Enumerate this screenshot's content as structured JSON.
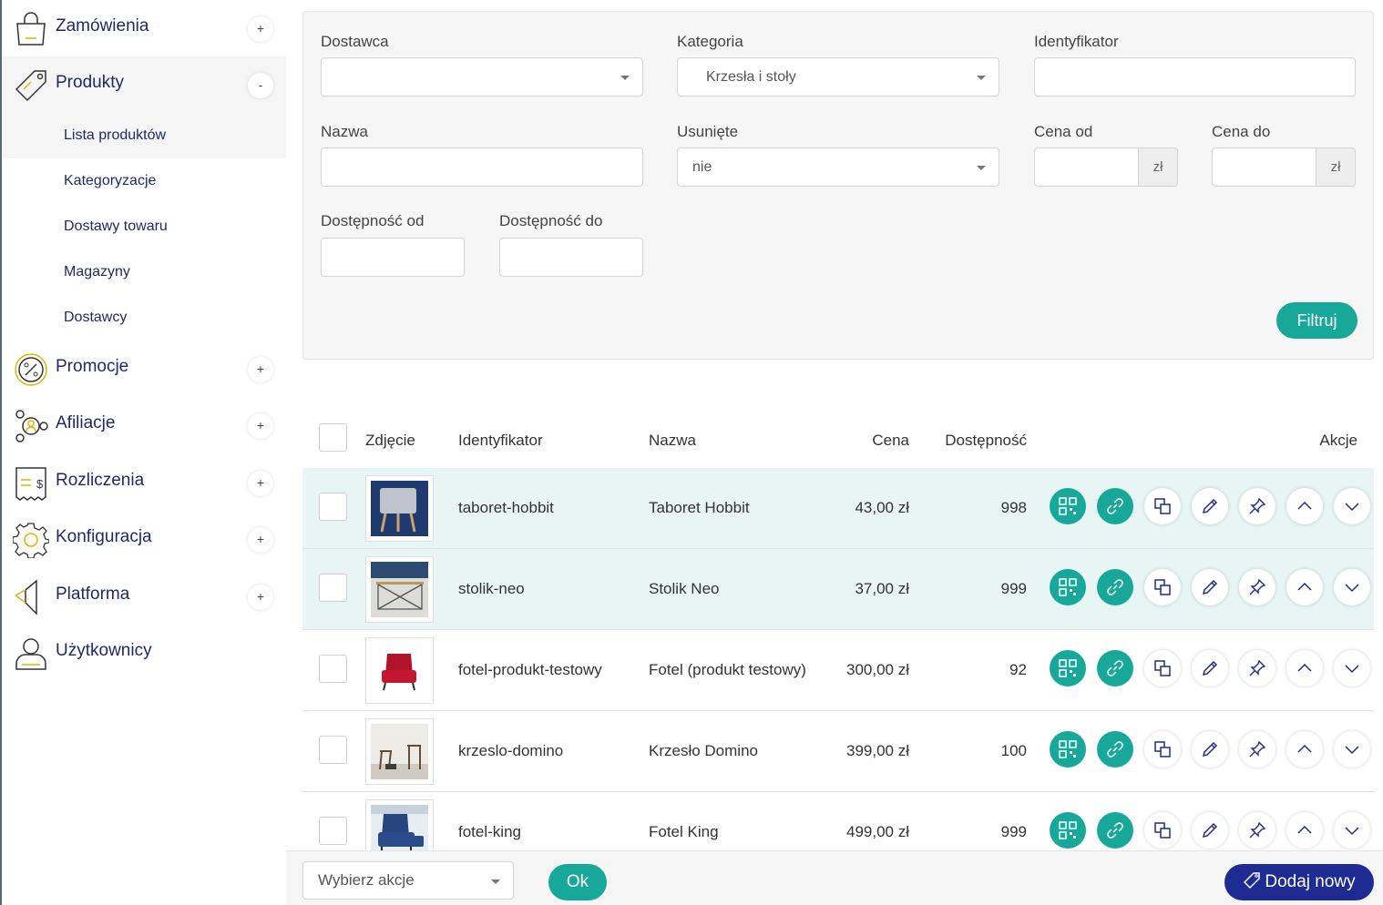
{
  "sidebar": {
    "items": [
      {
        "label": "Zamówienia",
        "toggle": "+",
        "icon": "shopping-bag-icon"
      },
      {
        "label": "Produkty",
        "toggle": "-",
        "icon": "price-tag-icon"
      },
      {
        "label": "Promocje",
        "toggle": "+",
        "icon": "percent-icon"
      },
      {
        "label": "Afiliacje",
        "toggle": "+",
        "icon": "network-users-icon"
      },
      {
        "label": "Rozliczenia",
        "toggle": "+",
        "icon": "receipt-icon"
      },
      {
        "label": "Konfiguracja",
        "toggle": "+",
        "icon": "gear-icon"
      },
      {
        "label": "Platforma",
        "toggle": "+",
        "icon": "platform-icon"
      },
      {
        "label": "Użytkownicy",
        "toggle": "",
        "icon": "user-icon"
      }
    ],
    "subitems": [
      "Lista produktów",
      "Kategoryzacje",
      "Dostawy towaru",
      "Magazyny",
      "Dostawcy"
    ]
  },
  "filters": {
    "supplier_label": "Dostawca",
    "supplier_value": "",
    "category_label": "Kategoria",
    "category_value": "Krzesła i stoły",
    "id_label": "Identyfikator",
    "id_value": "",
    "name_label": "Nazwa",
    "name_value": "",
    "deleted_label": "Usunięte",
    "deleted_value": "nie",
    "price_from_label": "Cena od",
    "price_to_label": "Cena do",
    "currency": "zł",
    "avail_from_label": "Dostępność od",
    "avail_to_label": "Dostępność do",
    "filter_button": "Filtruj"
  },
  "table": {
    "headers": {
      "photo": "Zdjęcie",
      "id": "Identyfikator",
      "name": "Nazwa",
      "price": "Cena",
      "availability": "Dostępność",
      "actions": "Akcje"
    },
    "rows": [
      {
        "id": "taboret-hobbit",
        "name": "Taboret Hobbit",
        "price": "43,00 zł",
        "availability": "998",
        "thumb": "stool-photo"
      },
      {
        "id": "stolik-neo",
        "name": "Stolik Neo",
        "price": "37,00 zł",
        "availability": "999",
        "thumb": "table-photo"
      },
      {
        "id": "fotel-produkt-testowy",
        "name": "Fotel (produkt testowy)",
        "price": "300,00 zł",
        "availability": "92",
        "thumb": "red-armchair-photo"
      },
      {
        "id": "krzeslo-domino",
        "name": "Krzesło Domino",
        "price": "399,00 zł",
        "availability": "100",
        "thumb": "chairs-photo"
      },
      {
        "id": "fotel-king",
        "name": "Fotel King",
        "price": "499,00 zł",
        "availability": "999",
        "thumb": "blue-armchair-photo"
      }
    ]
  },
  "bottom": {
    "bulk_select": "Wybierz akcje",
    "ok_button": "Ok",
    "add_button": "Dodaj nowy"
  },
  "colors": {
    "accent": "#17a89a",
    "primary": "#1e2b93",
    "nav_text": "#1f2a6b",
    "highlight_row": "#e7f6f4"
  }
}
